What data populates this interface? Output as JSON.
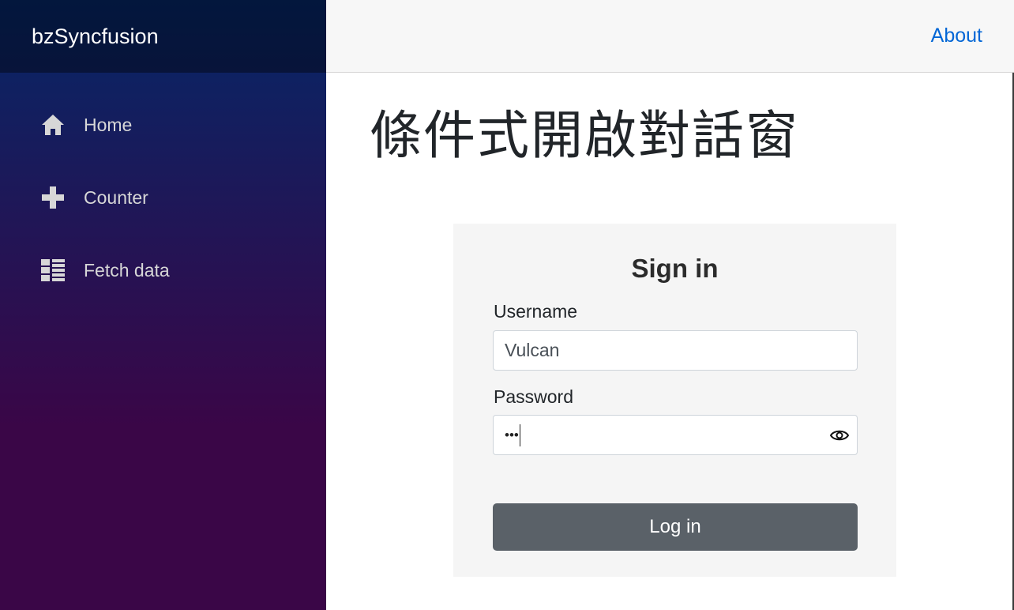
{
  "app": {
    "brand": "bzSyncfusion"
  },
  "sidebar": {
    "items": [
      {
        "label": "Home",
        "icon": "home-icon"
      },
      {
        "label": "Counter",
        "icon": "plus-icon"
      },
      {
        "label": "Fetch data",
        "icon": "list-icon"
      }
    ]
  },
  "topbar": {
    "about_label": "About"
  },
  "page": {
    "title": "條件式開啟對話窗"
  },
  "login": {
    "title": "Sign in",
    "username_label": "Username",
    "username_value": "Vulcan",
    "password_label": "Password",
    "password_mask": "•••",
    "submit_label": "Log in"
  },
  "colors": {
    "sidebar_top": "#052767",
    "sidebar_bottom": "#3a0647",
    "link": "#0366d6",
    "button": "#5a6168"
  }
}
